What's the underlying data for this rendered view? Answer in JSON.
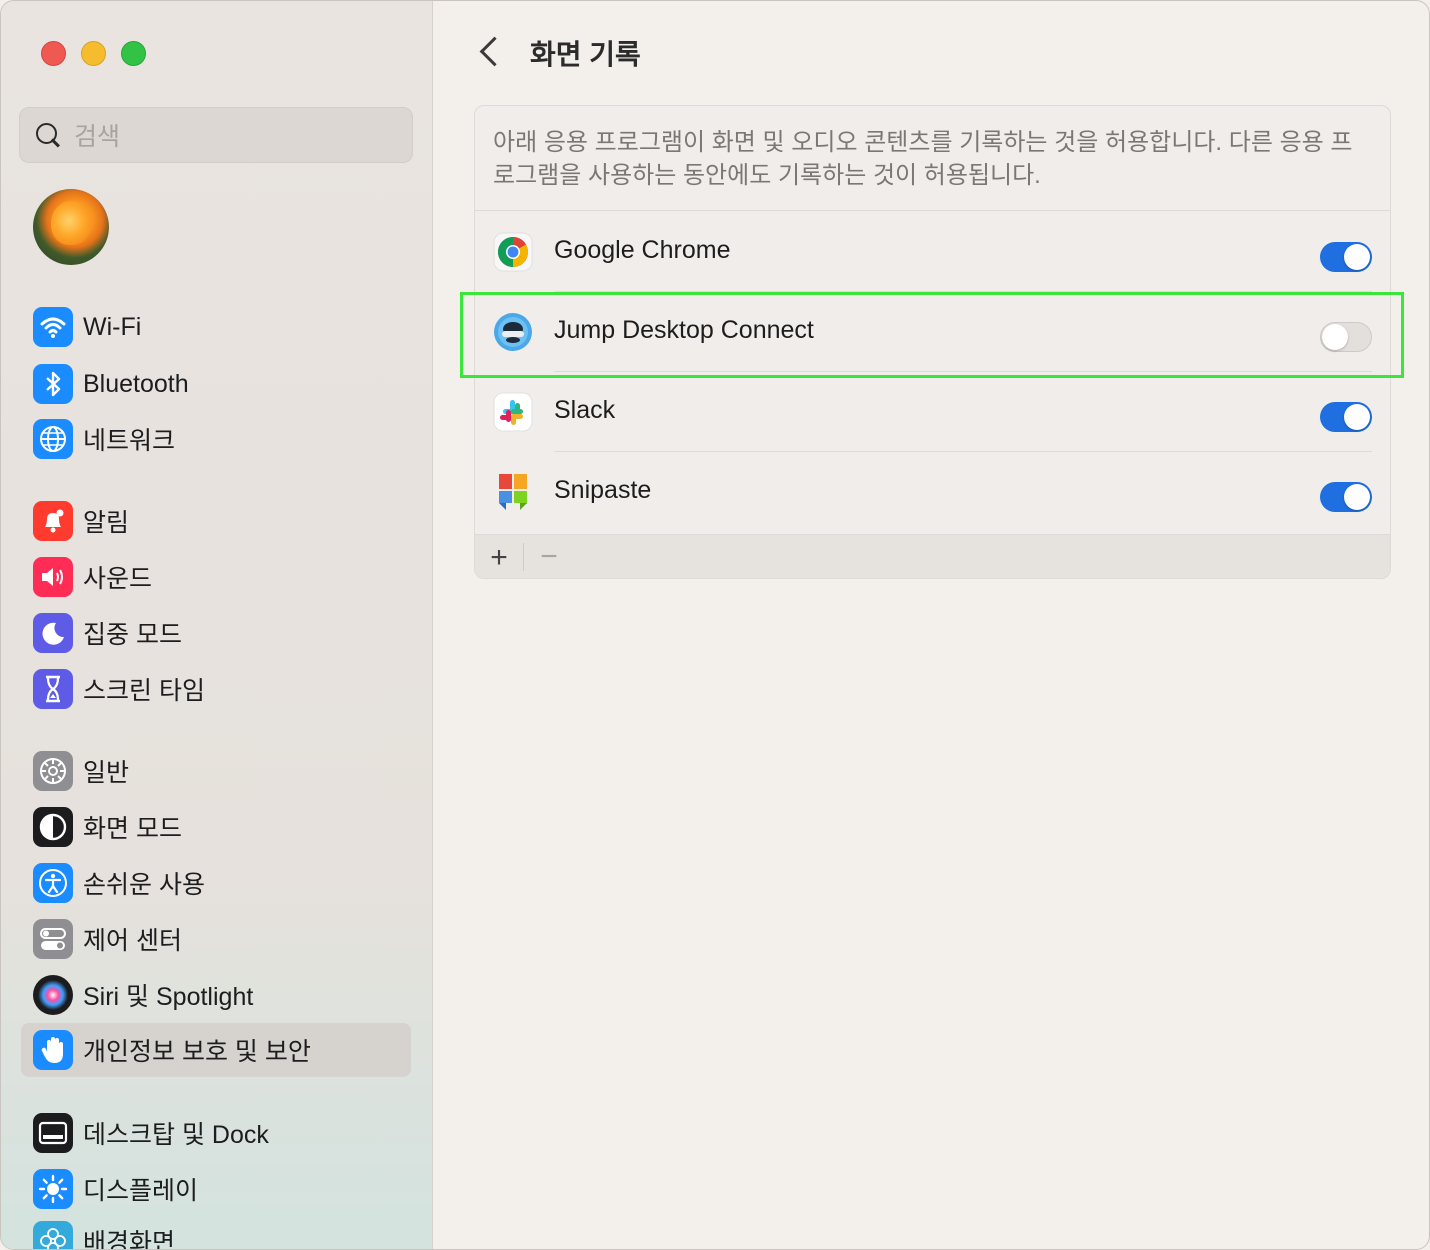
{
  "window": {
    "title": "화면 기록"
  },
  "search": {
    "placeholder": "검색"
  },
  "sidebar": {
    "items": [
      {
        "label": "Wi-Fi",
        "icon": "wifi-icon",
        "color": "#1a8cff"
      },
      {
        "label": "Bluetooth",
        "icon": "bluetooth-icon",
        "color": "#1a8cff"
      },
      {
        "label": "네트워크",
        "icon": "globe-icon",
        "color": "#1a8cff"
      },
      {
        "label": "알림",
        "icon": "bell-icon",
        "color": "#ff3b30"
      },
      {
        "label": "사운드",
        "icon": "speaker-icon",
        "color": "#ff2d55"
      },
      {
        "label": "집중 모드",
        "icon": "moon-icon",
        "color": "#5e5ce6"
      },
      {
        "label": "스크린 타임",
        "icon": "hourglass-icon",
        "color": "#5e5ce6"
      },
      {
        "label": "일반",
        "icon": "gear-icon",
        "color": "#8e8e93"
      },
      {
        "label": "화면 모드",
        "icon": "appearance-icon",
        "color": "#1c1c1e"
      },
      {
        "label": "손쉬운 사용",
        "icon": "accessibility-icon",
        "color": "#1a8cff"
      },
      {
        "label": "제어 센터",
        "icon": "switches-icon",
        "color": "#8e8e93"
      },
      {
        "label": "Siri 및 Spotlight",
        "icon": "siri-icon",
        "color": "#1c1c1e"
      },
      {
        "label": "개인정보 보호 및 보안",
        "icon": "hand-icon",
        "color": "#1a8cff",
        "selected": true
      },
      {
        "label": "데스크탑 및 Dock",
        "icon": "dock-icon",
        "color": "#1c1c1e"
      },
      {
        "label": "디스플레이",
        "icon": "sun-icon",
        "color": "#1a8cff"
      },
      {
        "label": "배경화면",
        "icon": "flower-icon",
        "color": "#34aadc"
      }
    ]
  },
  "main": {
    "description": "아래 응용 프로그램이 화면 및 오디오 콘텐츠를 기록하는 것을 허용합니다. 다른 응용 프로그램을 사용하는 동안에도 기록하는 것이 허용됩니다.",
    "apps": [
      {
        "name": "Google Chrome",
        "icon": "chrome-icon",
        "enabled": true
      },
      {
        "name": "Jump Desktop Connect",
        "icon": "jump-desktop-icon",
        "enabled": false
      },
      {
        "name": "Slack",
        "icon": "slack-icon",
        "enabled": true
      },
      {
        "name": "Snipaste",
        "icon": "snipaste-icon",
        "enabled": true
      }
    ],
    "footer": {
      "add_label": "+",
      "remove_label": "−"
    }
  },
  "colors": {
    "accent": "#1f6fe0",
    "highlight": "#39e639"
  }
}
